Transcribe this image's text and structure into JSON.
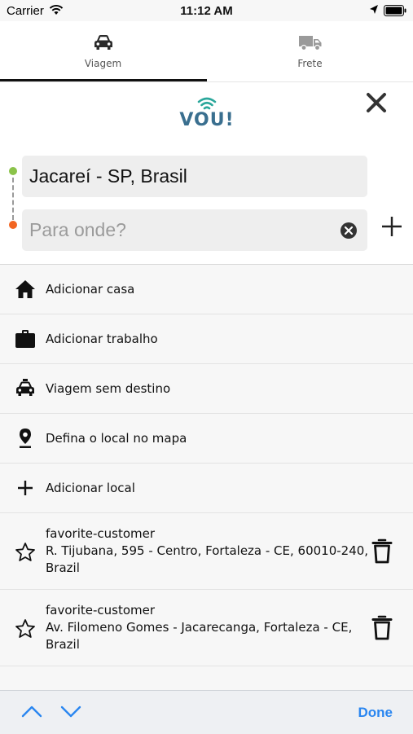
{
  "status_bar": {
    "carrier": "Carrier",
    "time": "11:12 AM"
  },
  "tabs": [
    {
      "label": "Viagem",
      "icon": "car-icon",
      "selected": true
    },
    {
      "label": "Frete",
      "icon": "truck-icon",
      "selected": false
    }
  ],
  "logo": {
    "text": "VOU!",
    "color": "#3a6f8f"
  },
  "route": {
    "origin": "Jacareí - SP, Brasil",
    "destination_value": "",
    "destination_placeholder": "Para onde?",
    "start_color": "#8bc34a",
    "end_color": "#f26522"
  },
  "options": [
    {
      "label": "Adicionar casa",
      "icon": "home-icon"
    },
    {
      "label": "Adicionar trabalho",
      "icon": "briefcase-icon"
    },
    {
      "label": "Viagem sem destino",
      "icon": "taxi-icon"
    },
    {
      "label": "Defina o local no mapa",
      "icon": "map-pin-icon"
    },
    {
      "label": "Adicionar local",
      "icon": "plus-icon"
    }
  ],
  "favorites": [
    {
      "name": "favorite-customer",
      "address_line1": "R. Tijubana, 595 - Centro, Fortaleza - CE, 60010-240,",
      "address_line2": "Brazil"
    },
    {
      "name": "favorite-customer",
      "address_line1": "Av. Filomeno Gomes - Jacarecanga, Fortaleza - CE,",
      "address_line2": "Brazil"
    }
  ],
  "toolbar": {
    "done_label": "Done",
    "accent": "#2a86f0"
  }
}
